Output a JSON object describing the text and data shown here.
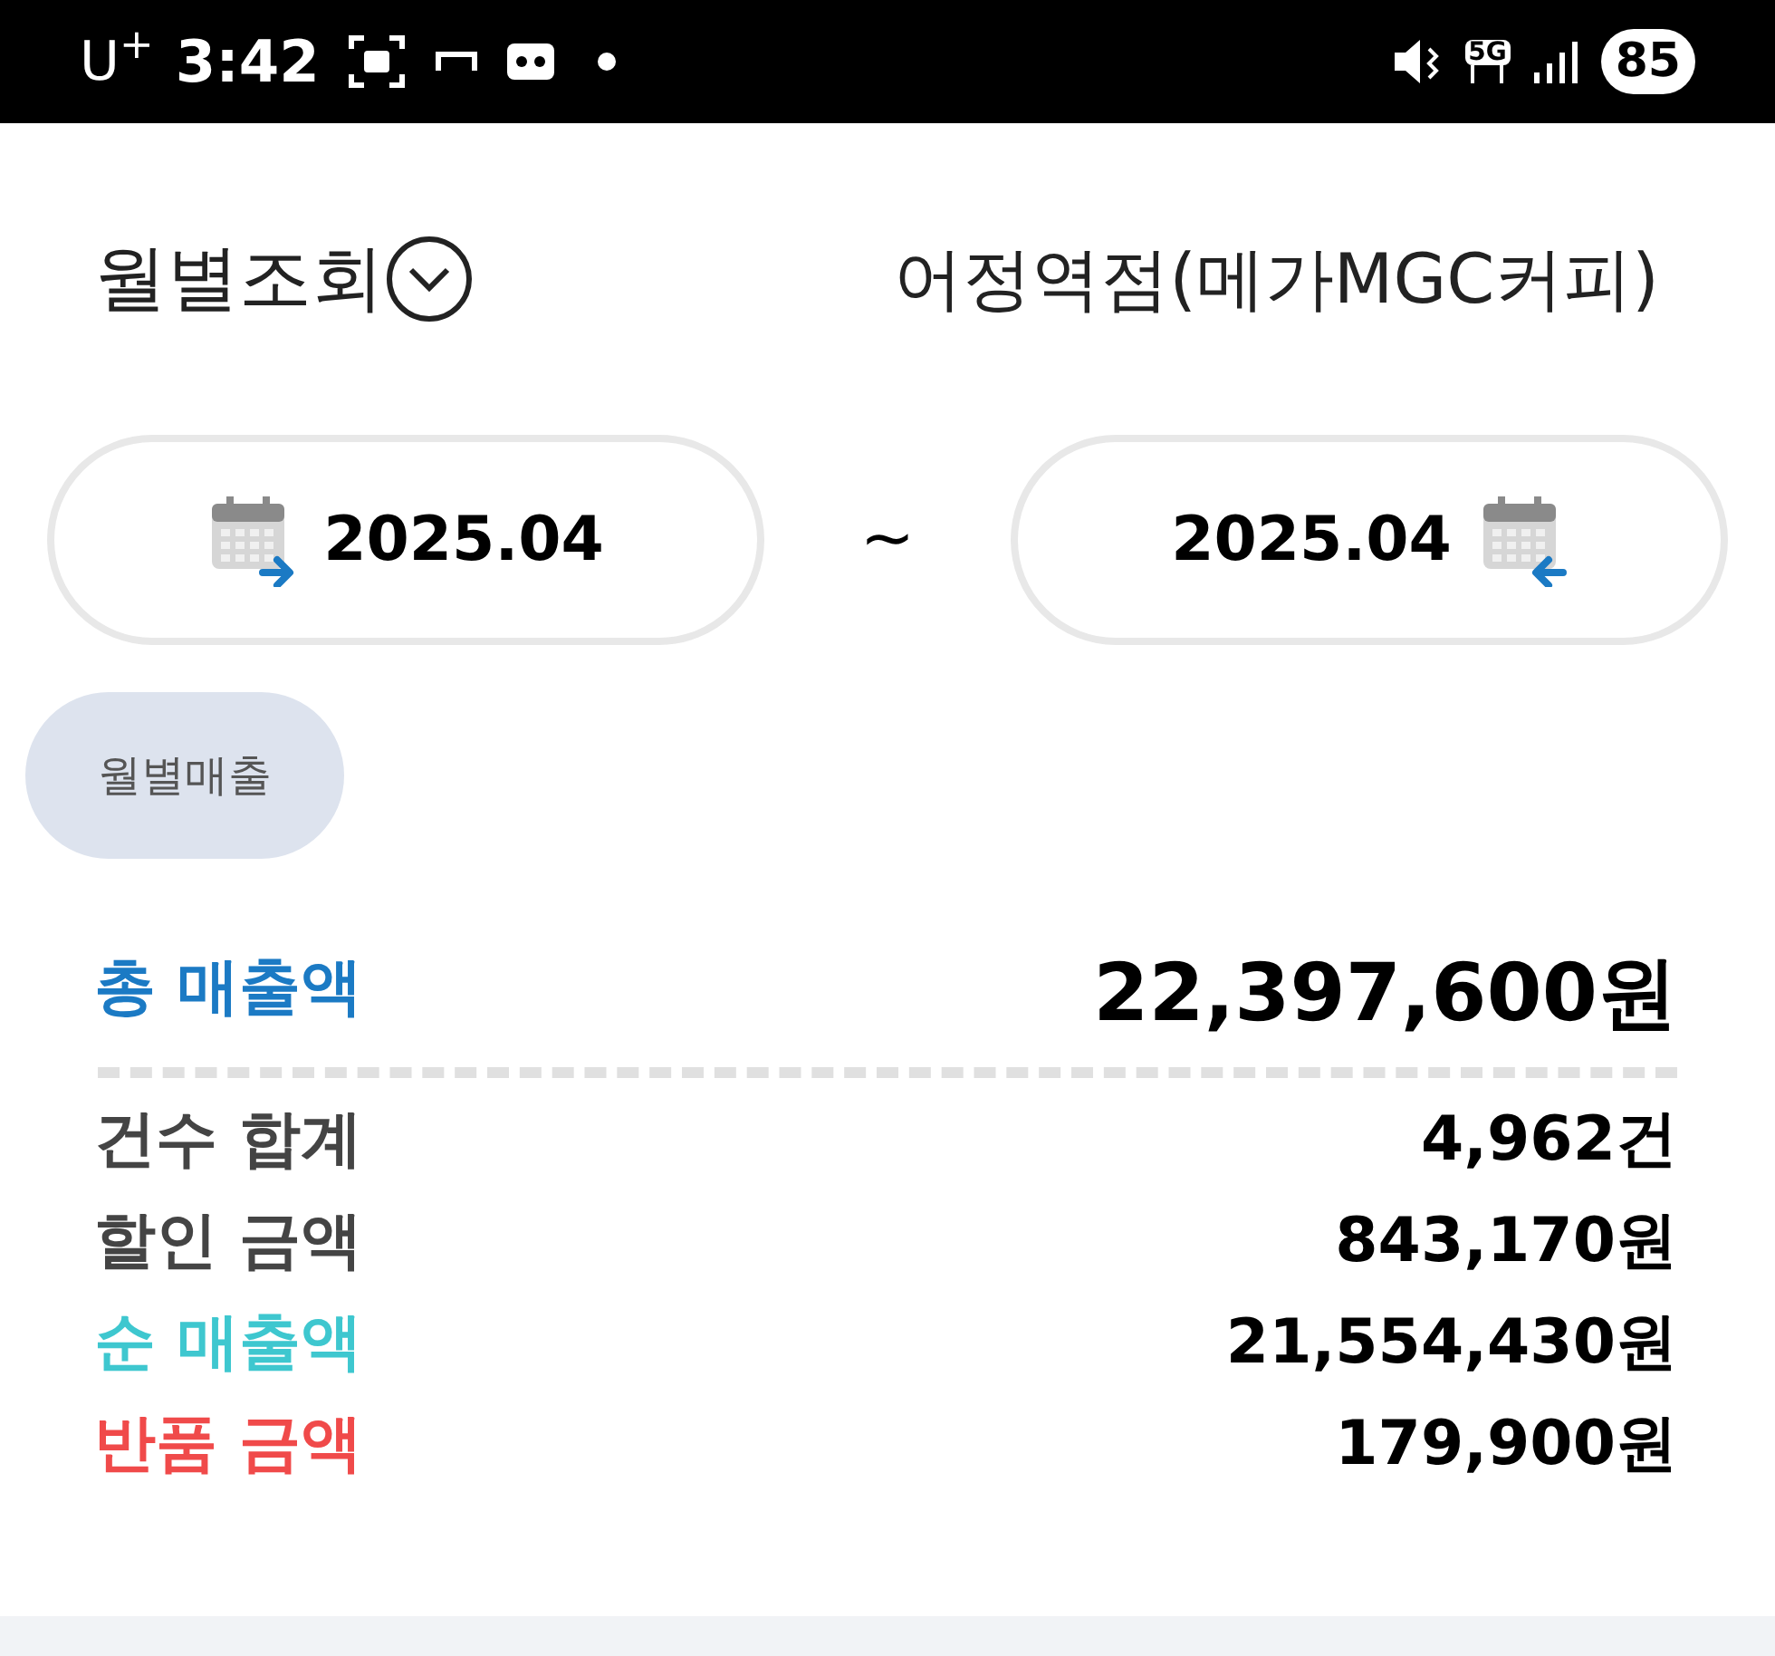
{
  "status_bar": {
    "carrier": "U$^{+}$",
    "time": "3:42",
    "network": "5G",
    "battery": "85"
  },
  "header": {
    "title": "월별조회",
    "store": "어정역점(메가MGC커피)"
  },
  "date_range": {
    "start": "2025.04",
    "separator": "~",
    "end": "2025.04"
  },
  "chips": [
    {
      "label": "월별매출",
      "selected": true
    }
  ],
  "total": {
    "label": "총 매출액",
    "value": "22,397,600원",
    "color": "#1b7ac4"
  },
  "summary": [
    {
      "label": "건수 합계",
      "value": "4,962건",
      "color": "#444444"
    },
    {
      "label": "할인 금액",
      "value": "843,170원",
      "color": "#444444"
    },
    {
      "label": "순 매출액",
      "value": "21,554,430원",
      "color": "#3ec7cf"
    },
    {
      "label": "반품 금액",
      "value": "179,900원",
      "color": "#f04a4a"
    }
  ]
}
